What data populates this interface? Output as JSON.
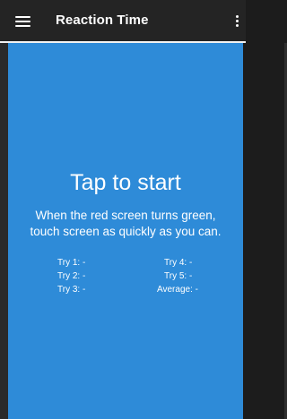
{
  "app_bar": {
    "title": "Reaction Time",
    "menu_icon": "hamburger-menu-icon",
    "overflow_icon": "more-vert-icon"
  },
  "main": {
    "background_color": "#2e8bd8",
    "headline": "Tap to start",
    "instructions_line1": "When the red screen turns green,",
    "instructions_line2": "touch screen as quickly as you can.",
    "results": {
      "try1": "Try 1: -",
      "try2": "Try 2: -",
      "try3": "Try 3: -",
      "try4": "Try 4: -",
      "try5": "Try 5: -",
      "average": "Average: -"
    }
  }
}
